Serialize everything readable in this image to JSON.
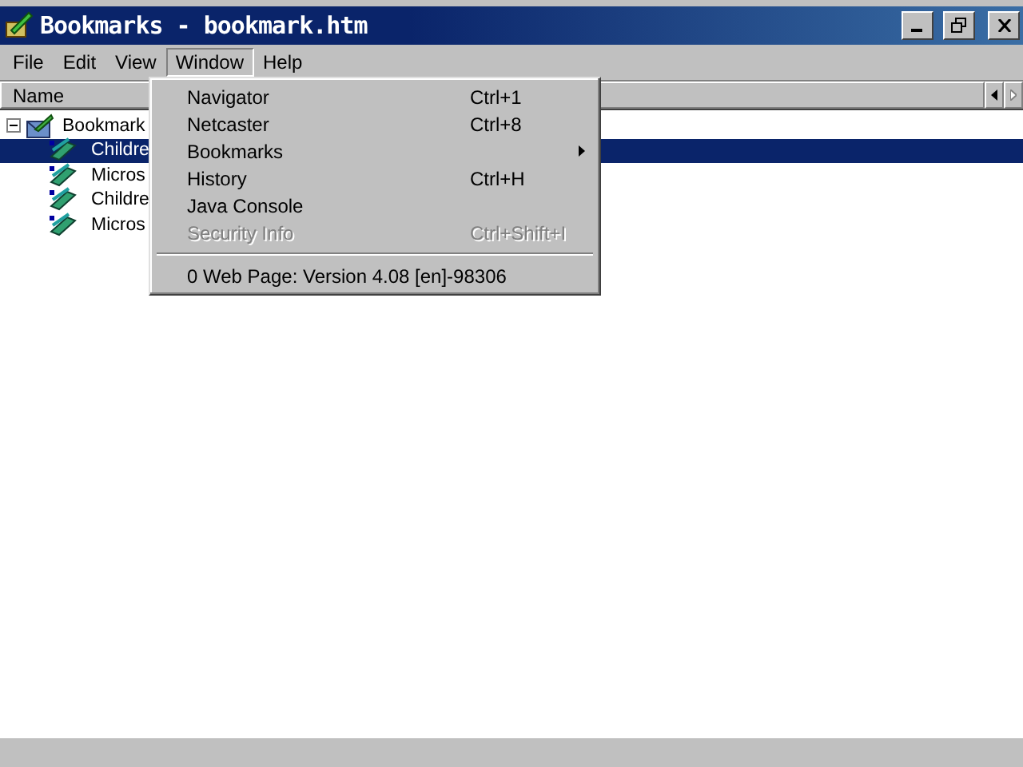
{
  "window": {
    "title": "Bookmarks - bookmark.htm"
  },
  "menu_bar": [
    {
      "label": "File",
      "selected": false
    },
    {
      "label": "Edit",
      "selected": false
    },
    {
      "label": "View",
      "selected": false
    },
    {
      "label": "Window",
      "selected": true
    },
    {
      "label": "Help",
      "selected": false
    }
  ],
  "tree": {
    "columns": [
      "Name"
    ],
    "items": [
      {
        "label": "Bookmark",
        "kind": "folder",
        "expanded": true,
        "selected": false,
        "children": [
          {
            "label": "Childre",
            "kind": "bookmark",
            "selected": true
          },
          {
            "label": "Micros",
            "kind": "bookmark",
            "selected": false
          },
          {
            "label": "Childre",
            "kind": "bookmark",
            "selected": false
          },
          {
            "label": "Micros",
            "kind": "bookmark",
            "selected": false
          }
        ]
      }
    ]
  },
  "window_menu": {
    "items": [
      {
        "label": "Navigator",
        "shortcut": "Ctrl+1",
        "disabled": false
      },
      {
        "label": "Netcaster",
        "shortcut": "Ctrl+8",
        "disabled": false
      },
      {
        "label": "Bookmarks",
        "submenu": true,
        "disabled": false
      },
      {
        "label": "History",
        "shortcut": "Ctrl+H",
        "disabled": false
      },
      {
        "label": "Java Console",
        "disabled": false
      },
      {
        "label": "Security Info",
        "shortcut": "Ctrl+Shift+I",
        "disabled": true
      },
      {
        "kind": "separator"
      },
      {
        "label": "0 Web Page: Version 4.08 [en]-98306",
        "disabled": false
      }
    ]
  }
}
